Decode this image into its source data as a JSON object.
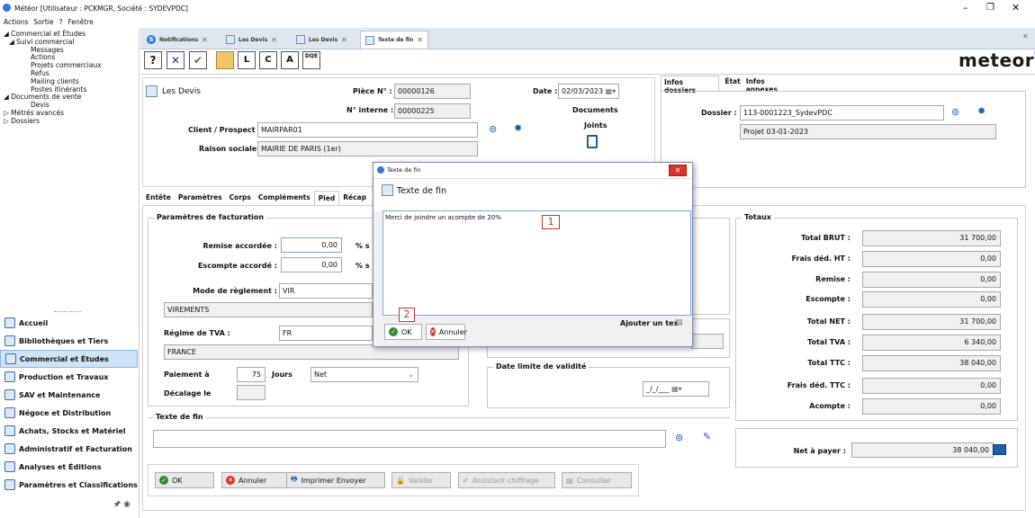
{
  "window": {
    "title": "Météor [Utilisateur : PCKMGR, Société : SYDEVPDC]",
    "menu": [
      "Actions",
      "Sortie",
      "?",
      "Fenêtre"
    ]
  },
  "sidebar": {
    "tree": [
      {
        "label": "Commercial et Études",
        "level": 0,
        "expanded": true
      },
      {
        "label": "Suivi commercial",
        "level": 1,
        "expanded": true
      },
      {
        "label": "Messages",
        "level": 2
      },
      {
        "label": "Actions",
        "level": 2
      },
      {
        "label": "Projets commerciaux",
        "level": 2
      },
      {
        "label": "Refus",
        "level": 2
      },
      {
        "label": "Mailing clients",
        "level": 2
      },
      {
        "label": "Postes itinérants",
        "level": 2
      },
      {
        "label": "Documents de vente",
        "level": 1,
        "expanded": true
      },
      {
        "label": "Devis",
        "level": 2
      },
      {
        "label": "Métrés avancés",
        "level": 1,
        "expanded": false
      },
      {
        "label": "Dossiers",
        "level": 1,
        "expanded": false
      }
    ],
    "categories": [
      "Accueil",
      "Bibliothèques et Tiers",
      "Commercial et Études",
      "Production et Travaux",
      "SAV et Maintenance",
      "Négoce et Distribution",
      "Achats, Stocks et Matériel",
      "Administratif et Facturation",
      "Analyses et Éditions",
      "Paramètres et Classifications"
    ],
    "active_category": "Commercial et Études"
  },
  "tabs": [
    "Notifications",
    "Les Devis",
    "Les Devis",
    "Texte de fin"
  ],
  "active_tab": "Texte de fin",
  "toolbar": {
    "icons": [
      "help-icon",
      "close-icon",
      "validate-icon",
      "folder-icon",
      "insert-line-icon",
      "insert-comment-icon",
      "insert-text-icon",
      "dqe-icon"
    ],
    "dqe_label": "DQE"
  },
  "brand": "meteor",
  "header": {
    "module_title": "Les Devis",
    "piece_label": "Pièce N° :",
    "piece_value": "00000126",
    "internal_label": "N° interne :",
    "internal_value": "00000225",
    "date_label": "Date :",
    "date_value": "02/03/2023",
    "docs_label": "Documents",
    "docs_label2": "Joints",
    "client_label": "Client / Prospect :",
    "client_value": "MAIRPAR01",
    "raison_label": "Raison sociale :",
    "raison_value": "MAIRIE DE PARIS (1er)"
  },
  "right_panel": {
    "tabs": [
      "Infos dossiers",
      "État",
      "Infos annexes"
    ],
    "dossier_label": "Dossier :",
    "dossier_value": "113-0001223_SydevPDC",
    "projet_value": "Projet 03-01-2023"
  },
  "form_tabs": [
    "Entête",
    "Paramètres",
    "Corps",
    "Compléments",
    "Pied",
    "Récap"
  ],
  "active_form_tab": "Pied",
  "facturation": {
    "title": "Paramètres de facturation",
    "remise_label": "Remise accordée :",
    "remise_value": "0,00",
    "remise_unit": "% s",
    "escompte_label": "Escompte accordé :",
    "escompte_value": "0,00",
    "escompte_unit": "% s",
    "mode_label": "Mode de règlement :",
    "mode_value": "VIR",
    "mode_desc": "VIREMENTS",
    "tva_label": "Régime de TVA :",
    "tva_value": "FR",
    "tva_desc": "FRANCE",
    "paiement_label": "Paiement  à",
    "paiement_days": "75",
    "jours_label": "Jours",
    "paiement_type": "Net",
    "decalage_label": "Décalage le"
  },
  "validite": {
    "title": "Date limite de validité",
    "value": "_/_/___"
  },
  "texte_fin": {
    "title": "Texte de fin",
    "value": ""
  },
  "totaux": {
    "title": "Totaux",
    "rows": [
      {
        "label": "Total BRUT :",
        "value": "31 700,00"
      },
      {
        "label": "Frais déd. HT :",
        "value": "0,00"
      },
      {
        "label": "Remise :",
        "value": "0,00"
      },
      {
        "label": "Escompte :",
        "value": "0,00"
      },
      {
        "label": "Total NET :",
        "value": "31 700,00"
      },
      {
        "label": "Total TVA :",
        "value": "6 340,00"
      },
      {
        "label": "Total TTC :",
        "value": "38 040,00"
      },
      {
        "label": "Frais déd. TTC :",
        "value": "0,00"
      },
      {
        "label": "Acompte :",
        "value": "0,00"
      }
    ],
    "net_label": "Net à payer :",
    "net_value": "38 040,00"
  },
  "bottom_buttons": [
    "OK",
    "Annuler",
    "Imprimer Envoyer",
    "Valider",
    "Assistant chiffrage",
    "Consulter"
  ],
  "dialog": {
    "title": "Texte de fin",
    "heading": "Texte de fin",
    "text": "Merci de joindre un acompte de 20%",
    "marker1": "1",
    "marker2": "2",
    "add_label": "Ajouter un tex",
    "ok": "OK",
    "cancel": "Annuler"
  },
  "colors": {
    "accent": "#1e5fa8",
    "dialog_marker": "#c0392b",
    "active_category_bg": "#cfe3f7",
    "brand": "#1a1a1a"
  }
}
